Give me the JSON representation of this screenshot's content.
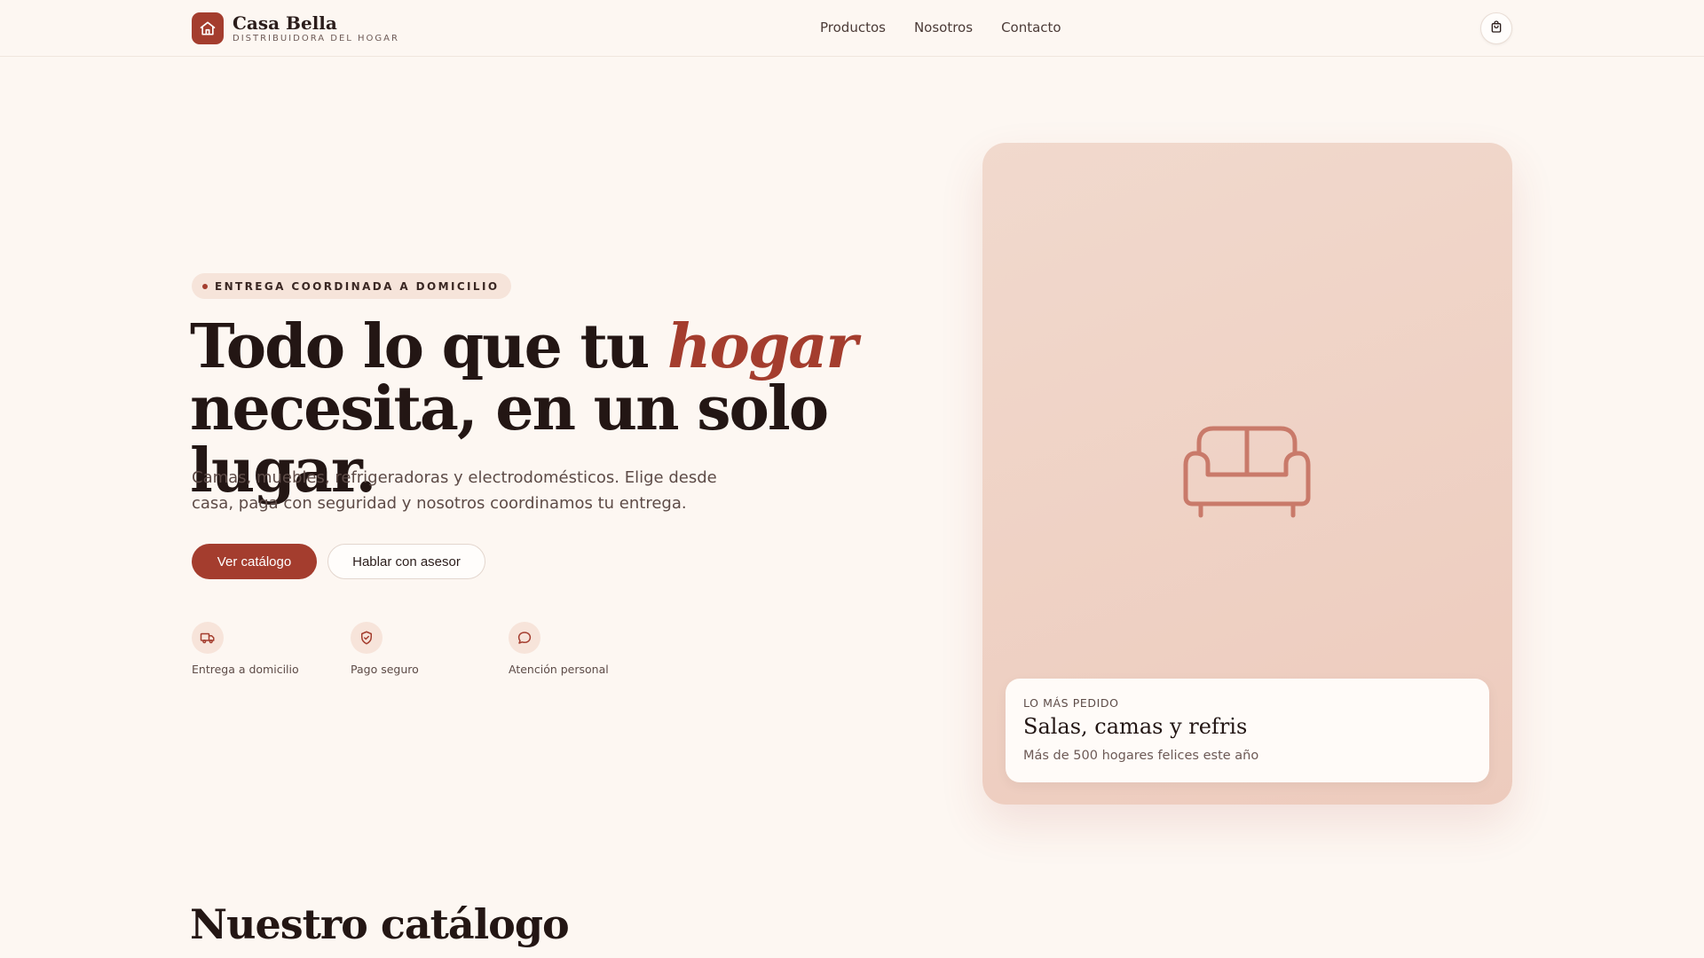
{
  "header": {
    "brand_name": "Casa Bella",
    "brand_tagline": "DISTRIBUIDORA DEL HOGAR",
    "logo_icon": "home-icon",
    "nav": [
      "Productos",
      "Nosotros",
      "Contacto"
    ],
    "cart_icon": "shopping-bag-icon"
  },
  "hero": {
    "badge": "ENTREGA COORDINADA A DOMICILIO",
    "headline_part1": "Todo lo que tu ",
    "headline_accent": "hogar",
    "headline_part2": "necesita, en un solo lugar.",
    "lede": "Camas, muebles, refrigeradoras y electrodomésticos. Elige desde casa, paga con seguridad y nosotros coordinamos tu entrega.",
    "cta_primary": "Ver catálogo",
    "cta_secondary": "Hablar con asesor",
    "features": [
      {
        "label": "Entrega a domicilio",
        "icon": "truck-icon"
      },
      {
        "label": "Pago seguro",
        "icon": "shield-check-icon"
      },
      {
        "label": "Atención personal",
        "icon": "chat-bubble-icon"
      }
    ]
  },
  "featured_card": {
    "illustration_icon": "sofa-icon",
    "kicker": "LO MÁS PEDIDO",
    "title": "Salas, camas y refris",
    "subtitle": "Más de 500 hogares felices este año"
  },
  "catalog": {
    "title": "Nuestro catálogo"
  },
  "colors": {
    "accent": "#a43d2e",
    "background": "#fdf7f2",
    "card_tint": "#efd0c3",
    "text_dark": "#231614"
  }
}
